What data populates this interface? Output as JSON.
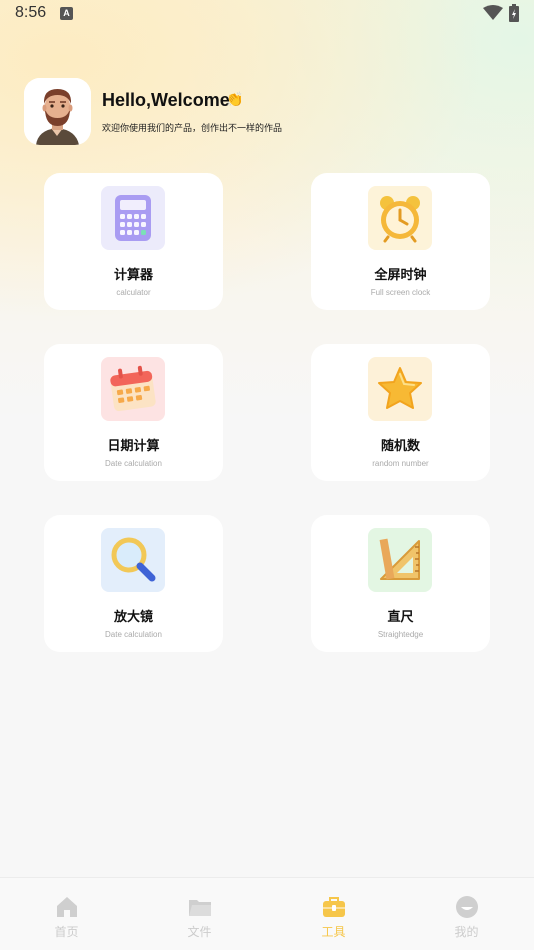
{
  "status_bar": {
    "time": "8:56",
    "notification_icon": "a-icon"
  },
  "header": {
    "greeting": "Hello,Welcome",
    "wave_emoji": "👏",
    "subtitle": "欢迎你使用我们的产品，创作出不一样的作品"
  },
  "tools": [
    {
      "title": "计算器",
      "subtitle": "calculator",
      "icon": "calculator-icon",
      "bg": "#ecebfb"
    },
    {
      "title": "全屏时钟",
      "subtitle": "Full screen clock",
      "icon": "alarm-clock-icon",
      "bg": "#fdf3d9"
    },
    {
      "title": "日期计算",
      "subtitle": "Date calculation",
      "icon": "calendar-icon",
      "bg": "#fde3e3"
    },
    {
      "title": "随机数",
      "subtitle": "random number",
      "icon": "star-icon",
      "bg": "#fdf1d8"
    },
    {
      "title": "放大镜",
      "subtitle": "Date calculation",
      "icon": "magnifier-icon",
      "bg": "#e3eefb"
    },
    {
      "title": "直尺",
      "subtitle": "Straightedge",
      "icon": "ruler-icon",
      "bg": "#e3f6e3"
    }
  ],
  "bottom_nav": [
    {
      "label": "首页",
      "icon": "home-icon",
      "active": false
    },
    {
      "label": "文件",
      "icon": "folder-icon",
      "active": false
    },
    {
      "label": "工具",
      "icon": "toolbox-icon",
      "active": true
    },
    {
      "label": "我的",
      "icon": "profile-icon",
      "active": false
    }
  ],
  "colors": {
    "accent": "#f6c64a",
    "inactive": "#cccccc"
  }
}
